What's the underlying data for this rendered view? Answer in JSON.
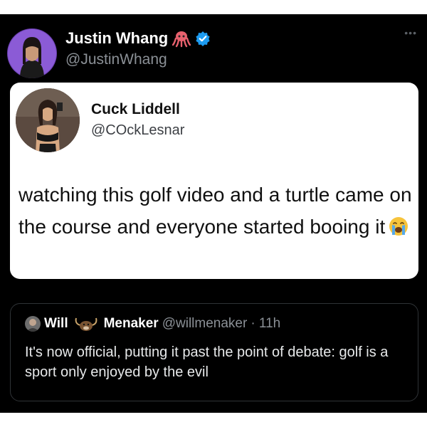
{
  "author": {
    "name": "Justin Whang",
    "handle": "@JustinWhang"
  },
  "quoted": {
    "name": "Cuck Liddell",
    "handle": "@COckLesnar",
    "text": "watching this golf video and a turtle came on the course and everyone started booing it"
  },
  "inner_quote": {
    "first_name": "Will",
    "last_name": "Menaker",
    "handle": "@willmenaker",
    "time": "· 11h",
    "text": "It's now official, putting it past the point of debate: golf is a sport only enjoyed by the evil"
  },
  "colors": {
    "background": "#000000",
    "verified": "#1d9bf0",
    "muted_text": "#8b9096"
  },
  "icons": [
    "octopus-emoji-icon",
    "verified-badge-icon",
    "more-options-icon",
    "crying-face-emoji-icon",
    "decoration-emoji-icon"
  ]
}
